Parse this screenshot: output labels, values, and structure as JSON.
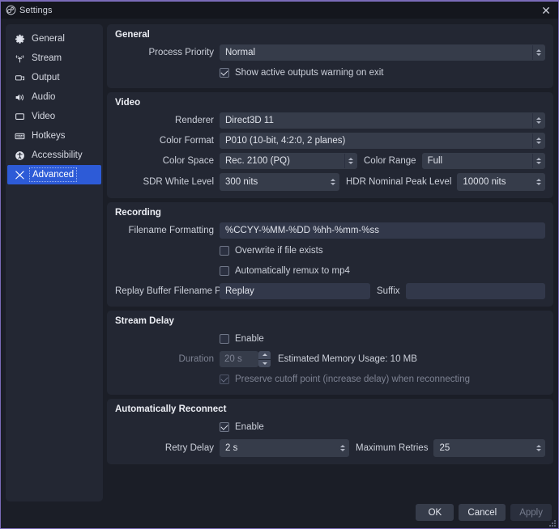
{
  "window": {
    "title": "Settings",
    "icon": "obs-logo-icon",
    "close_label": "✕"
  },
  "sidebar": {
    "items": [
      {
        "label": "General",
        "icon": "gear-icon",
        "selected": false
      },
      {
        "label": "Stream",
        "icon": "broadcast-icon",
        "selected": false
      },
      {
        "label": "Output",
        "icon": "output-screen-icon",
        "selected": false
      },
      {
        "label": "Audio",
        "icon": "speaker-icon",
        "selected": false
      },
      {
        "label": "Video",
        "icon": "monitor-icon",
        "selected": false
      },
      {
        "label": "Hotkeys",
        "icon": "keyboard-icon",
        "selected": false
      },
      {
        "label": "Accessibility",
        "icon": "accessibility-icon",
        "selected": false
      },
      {
        "label": "Advanced",
        "icon": "wrench-icon",
        "selected": true
      }
    ]
  },
  "general": {
    "title": "General",
    "process_priority_label": "Process Priority",
    "process_priority_value": "Normal",
    "show_warning_label": "Show active outputs warning on exit",
    "show_warning_checked": true
  },
  "video": {
    "title": "Video",
    "renderer_label": "Renderer",
    "renderer_value": "Direct3D 11",
    "color_format_label": "Color Format",
    "color_format_value": "P010 (10-bit, 4:2:0, 2 planes)",
    "color_space_label": "Color Space",
    "color_space_value": "Rec. 2100 (PQ)",
    "color_range_label": "Color Range",
    "color_range_value": "Full",
    "sdr_white_label": "SDR White Level",
    "sdr_white_value": "300 nits",
    "hdr_peak_label": "HDR Nominal Peak Level",
    "hdr_peak_value": "10000 nits"
  },
  "recording": {
    "title": "Recording",
    "filename_format_label": "Filename Formatting",
    "filename_format_value": "%CCYY-%MM-%DD %hh-%mm-%ss",
    "overwrite_label": "Overwrite if file exists",
    "overwrite_checked": false,
    "remux_label": "Automatically remux to mp4",
    "remux_checked": false,
    "replay_prefix_label": "Replay Buffer Filename Prefix",
    "replay_prefix_value": "Replay",
    "suffix_label": "Suffix",
    "suffix_value": ""
  },
  "stream_delay": {
    "title": "Stream Delay",
    "enable_label": "Enable",
    "enable_checked": false,
    "duration_label": "Duration",
    "duration_value": "20 s",
    "memory_note": "Estimated Memory Usage: 10 MB",
    "preserve_label": "Preserve cutoff point (increase delay) when reconnecting",
    "preserve_checked": true
  },
  "auto_reconnect": {
    "title": "Automatically Reconnect",
    "enable_label": "Enable",
    "enable_checked": true,
    "retry_delay_label": "Retry Delay",
    "retry_delay_value": "2 s",
    "max_retries_label": "Maximum Retries",
    "max_retries_value": "25"
  },
  "footer": {
    "ok_label": "OK",
    "cancel_label": "Cancel",
    "apply_label": "Apply"
  },
  "colors": {
    "window_bg": "#1b1e27",
    "panel_bg": "#232733",
    "field_bg": "#363c4a",
    "accent_selected": "#2d5bd7",
    "border_accent": "#7a6bb8",
    "text": "#d6d9e2",
    "text_dim": "#7d8292"
  }
}
